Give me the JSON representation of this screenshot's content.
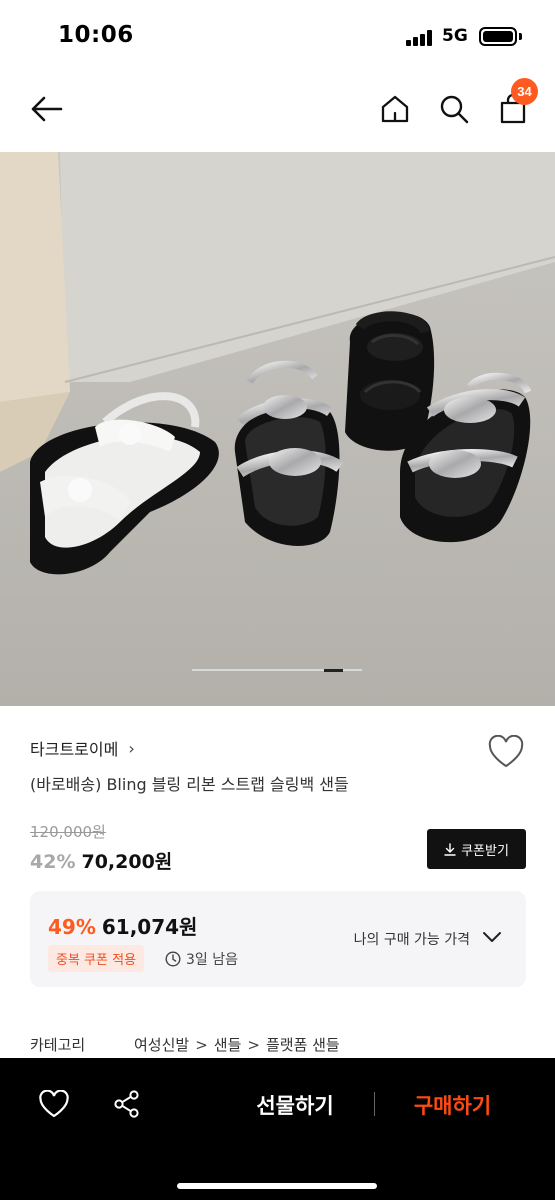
{
  "status_bar": {
    "time": "10:06",
    "network": "5G"
  },
  "top_nav": {
    "cart_count": "34"
  },
  "carousel": {
    "total_slides": 9,
    "active_index": 7
  },
  "product": {
    "brand": "타크트로이메",
    "brand_chevron": "›",
    "title": "(바로배송) Bling 블링 리본 스트랩 슬링백 샌들",
    "original_price": "120,000원",
    "discount_rate": "42%",
    "sale_price": "70,200원",
    "coupon_label": "쿠폰받기"
  },
  "best_price": {
    "discount_rate": "49%",
    "price": "61,074원",
    "badge": "중복 쿠폰 적용",
    "time_left": "3일 남음",
    "label": "나의 구매 가능 가격"
  },
  "category": {
    "label": "카테고리",
    "crumbs": [
      "여성신발",
      "샌들",
      "플랫폼 샌들"
    ],
    "separator": ">"
  },
  "bottom_bar": {
    "gift_label": "선물하기",
    "buy_label": "구매하기"
  },
  "colors": {
    "accent": "#ff5a1f",
    "buy": "#ff4a14",
    "dark": "#111111"
  },
  "icons": [
    "back-arrow-icon",
    "home-icon",
    "search-icon",
    "cart-icon",
    "heart-icon",
    "download-icon",
    "clock-icon",
    "chevron-down-icon",
    "share-icon"
  ]
}
